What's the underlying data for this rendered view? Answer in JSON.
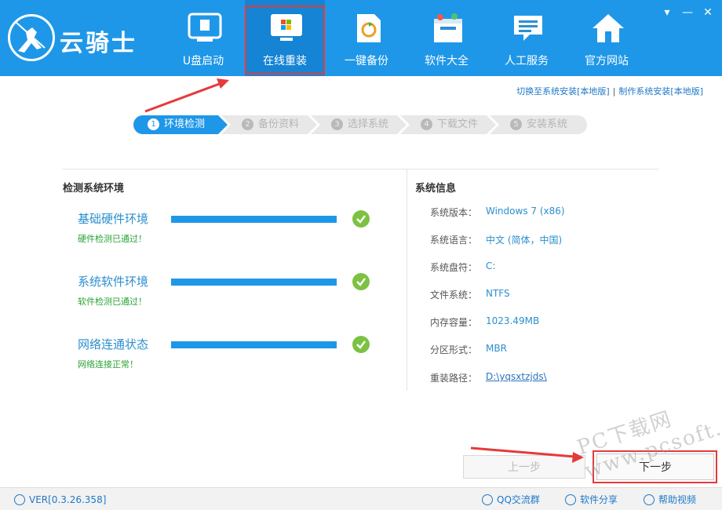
{
  "app": {
    "logo_text": "云骑士"
  },
  "nav": [
    {
      "label": "U盘启动",
      "icon": "usb-drive-icon"
    },
    {
      "label": "在线重装",
      "icon": "windows-monitor-icon"
    },
    {
      "label": "一键备份",
      "icon": "backup-file-icon"
    },
    {
      "label": "软件大全",
      "icon": "software-box-icon"
    },
    {
      "label": "人工服务",
      "icon": "chat-support-icon"
    },
    {
      "label": "官方网站",
      "icon": "home-icon"
    }
  ],
  "window_controls": {
    "menu": "▾",
    "minimize": "—",
    "close": "✕"
  },
  "top_links": {
    "switch_local": "切换至系统安装[本地版]",
    "separator": "|",
    "make_local": "制作系统安装[本地版]"
  },
  "steps": [
    {
      "num": "1",
      "label": "环境检测",
      "active": true
    },
    {
      "num": "2",
      "label": "备份资料",
      "active": false
    },
    {
      "num": "3",
      "label": "选择系统",
      "active": false
    },
    {
      "num": "4",
      "label": "下载文件",
      "active": false
    },
    {
      "num": "5",
      "label": "安装系统",
      "active": false
    }
  ],
  "detect": {
    "title": "检测系统环境",
    "items": [
      {
        "label": "基础硬件环境",
        "status": "硬件检测已通过！",
        "progress": 1.0
      },
      {
        "label": "系统软件环境",
        "status": "软件检测已通过！",
        "progress": 1.0
      },
      {
        "label": "网络连通状态",
        "status": "网络连接正常！",
        "progress": 1.0
      }
    ]
  },
  "sysinfo": {
    "title": "系统信息",
    "rows": [
      {
        "key": "系统版本：",
        "value": "Windows 7 (x86)"
      },
      {
        "key": "系统语言：",
        "value": "中文 (简体，中国)"
      },
      {
        "key": "系统盘符：",
        "value": "C:"
      },
      {
        "key": "文件系统：",
        "value": "NTFS"
      },
      {
        "key": "内存容量：",
        "value": "1023.49MB"
      },
      {
        "key": "分区形式：",
        "value": "MBR"
      },
      {
        "key": "重装路径：",
        "value": "D:\\yqsxtzjds\\"
      }
    ]
  },
  "buttons": {
    "prev": "上一步",
    "next": "下一步"
  },
  "watermark": "PC下载网 www.pcsoft.com.cn",
  "footer": {
    "version": "VER[0.3.26.358]",
    "qq": "QQ交流群",
    "share": "软件分享",
    "help": "帮助视频"
  },
  "colors": {
    "header_blue": "#1f97e8",
    "active_nav": "#1584d4",
    "highlight_red": "#e53a3a",
    "check_green": "#7cc242",
    "status_green": "#2aa335"
  }
}
